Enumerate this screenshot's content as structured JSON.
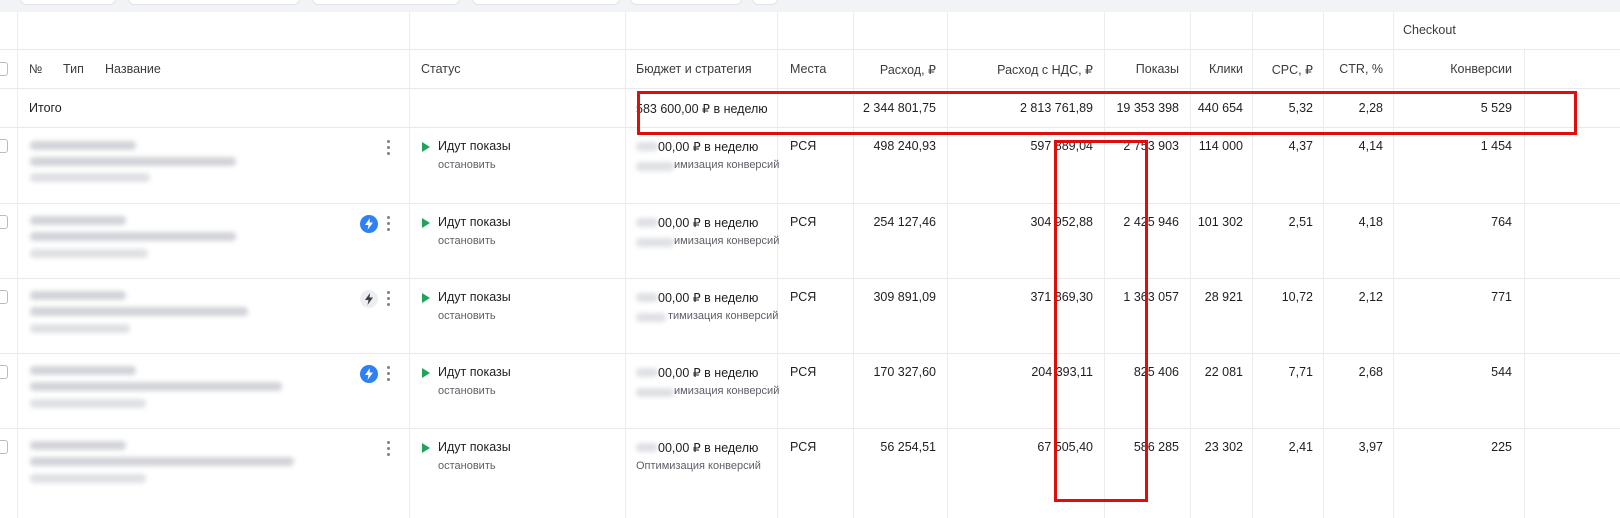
{
  "header": {
    "checkout_label": "Checkout",
    "col_no": "№",
    "col_type": "Тип",
    "col_name": "Название",
    "col_status": "Статус",
    "col_budget": "Бюджет и стратегия",
    "col_places": "Места",
    "col_spend": "Расход, ₽",
    "col_spend_vat": "Расход с НДС, ₽",
    "col_impressions": "Показы",
    "col_clicks": "Клики",
    "col_cpc": "CPC, ₽",
    "col_ctr": "CTR, %",
    "col_conversions": "Конверсии"
  },
  "total": {
    "label": "Итого",
    "budget": "583 600,00 ₽ в неделю",
    "spend": "2 344 801,75",
    "spend_vat": "2 813 761,89",
    "impressions": "19 353 398",
    "clicks": "440 654",
    "cpc": "5,32",
    "ctr": "2,28",
    "conversions": "5 529"
  },
  "rows": [
    {
      "status": "Идут показы",
      "action": "остановить",
      "budget": "00,00 ₽ в неделю",
      "strategy": "имизация конверсий",
      "places": "РСЯ",
      "spend": "498 240,93",
      "spend_vat": "597 889,04",
      "impressions": "2 753 903",
      "clicks": "114 000",
      "cpc": "4,37",
      "ctr": "4,14",
      "conversions": "1 454"
    },
    {
      "status": "Идут показы",
      "action": "остановить",
      "budget": "00,00 ₽ в неделю",
      "strategy": "имизация конверсий",
      "places": "РСЯ",
      "spend": "254 127,46",
      "spend_vat": "304 952,88",
      "impressions": "2 425 946",
      "clicks": "101 302",
      "cpc": "2,51",
      "ctr": "4,18",
      "conversions": "764"
    },
    {
      "status": "Идут показы",
      "action": "остановить",
      "budget": "00,00 ₽ в неделю",
      "strategy": "тимизация конверсий",
      "places": "РСЯ",
      "spend": "309 891,09",
      "spend_vat": "371 869,30",
      "impressions": "1 363 057",
      "clicks": "28 921",
      "cpc": "10,72",
      "ctr": "2,12",
      "conversions": "771"
    },
    {
      "status": "Идут показы",
      "action": "остановить",
      "budget": "00,00 ₽ в неделю",
      "strategy": "имизация конверсий",
      "places": "РСЯ",
      "spend": "170 327,60",
      "spend_vat": "204 393,11",
      "impressions": "825 406",
      "clicks": "22 081",
      "cpc": "7,71",
      "ctr": "2,68",
      "conversions": "544"
    },
    {
      "status": "Идут показы",
      "action": "остановить",
      "budget": "00,00 ₽ в неделю",
      "strategy": "Оптимизация конверсий",
      "places": "РСЯ",
      "spend": "56 254,51",
      "spend_vat": "67 505,40",
      "impressions": "586 285",
      "clicks": "23 302",
      "cpc": "2,41",
      "ctr": "3,97",
      "conversions": "225"
    }
  ],
  "colors": {
    "highlight": "#e00d0d",
    "status_green": "#22a35a",
    "bolt_blue": "#2f7ff5"
  }
}
